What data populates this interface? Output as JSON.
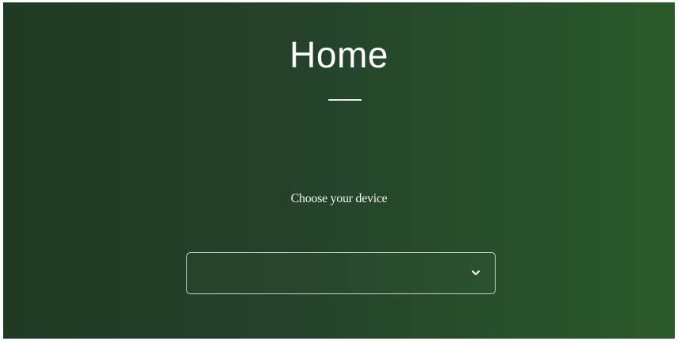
{
  "page": {
    "title": "Home",
    "prompt": "Choose your device"
  },
  "device_select": {
    "selected_value": "",
    "icon": "chevron-down-icon"
  },
  "colors": {
    "background_start": "#213a23",
    "background_end": "#2a5a2a",
    "text": "#ffffff",
    "border": "#c9d3c9"
  }
}
